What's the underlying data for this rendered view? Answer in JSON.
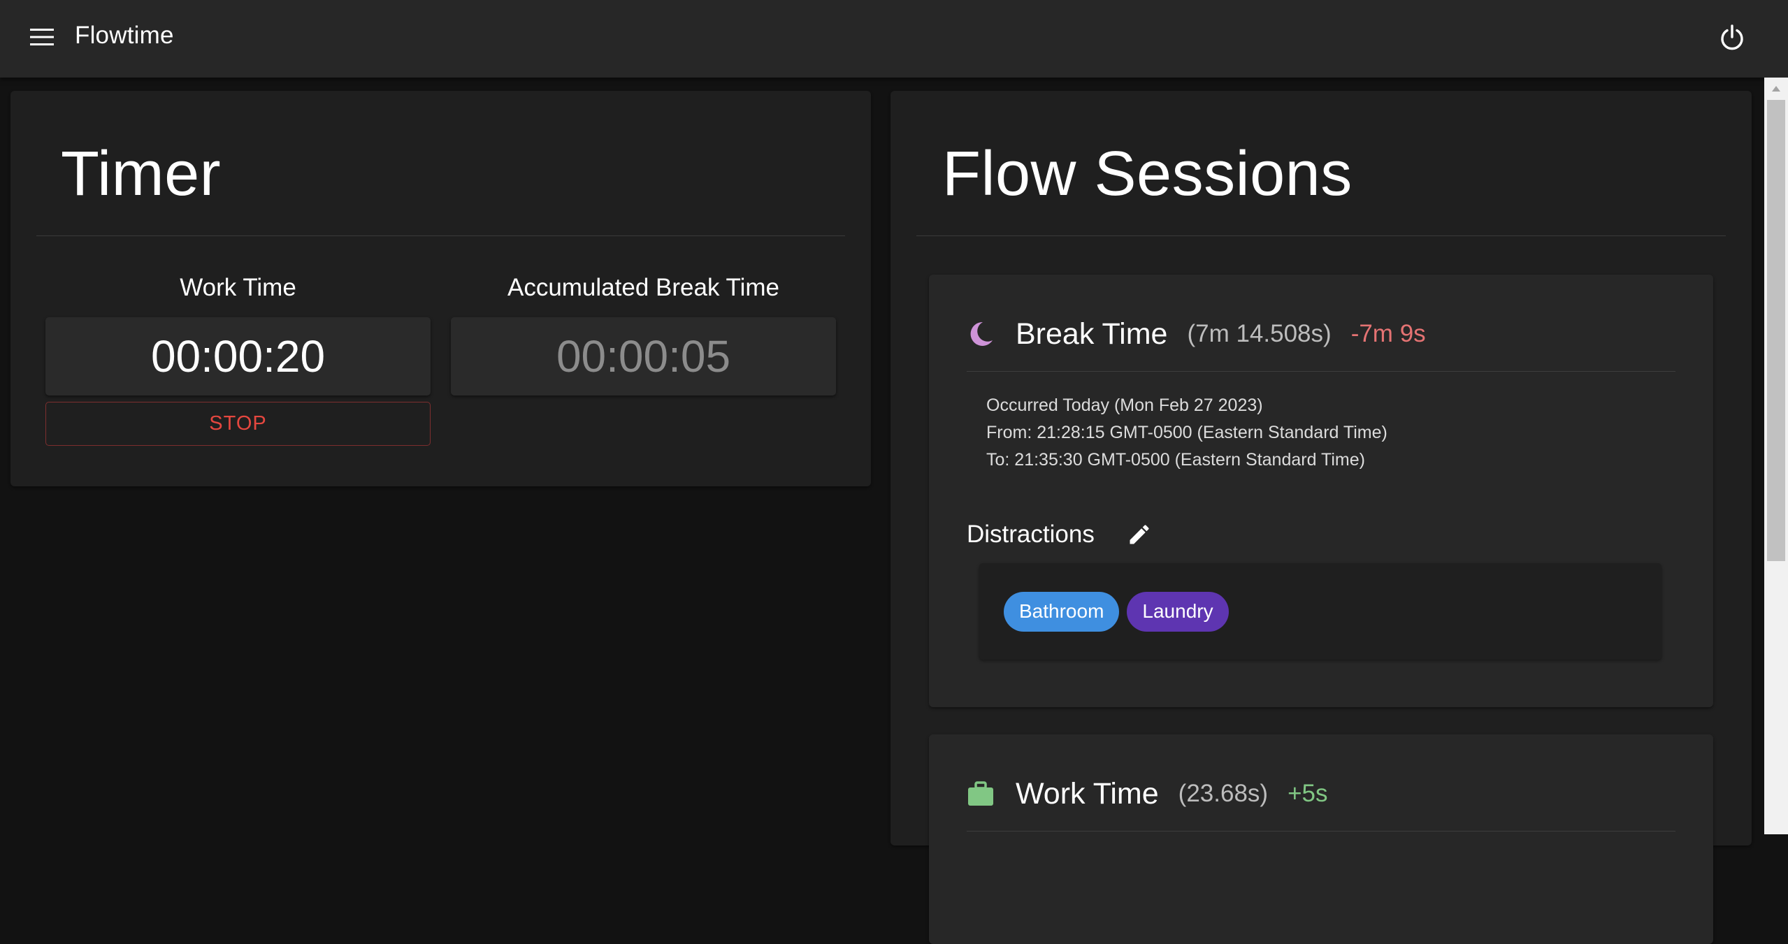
{
  "app": {
    "title": "Flowtime",
    "menu_icon": "hamburger-menu-icon",
    "power_icon": "power-icon"
  },
  "timer": {
    "title": "Timer",
    "work_label": "Work Time",
    "work_value": "00:00:20",
    "break_label": "Accumulated Break Time",
    "break_value": "00:00:05",
    "stop_label": "STOP"
  },
  "sessions": {
    "title": "Flow Sessions",
    "items": [
      {
        "type": "break",
        "icon": "moon-icon",
        "title": "Break Time",
        "duration": "(7m 14.508s)",
        "delta": "-7m 9s",
        "occurred": "Occurred Today (Mon Feb 27 2023)",
        "from": "From: 21:28:15 GMT-0500 (Eastern Standard Time)",
        "to": "To: 21:35:30 GMT-0500 (Eastern Standard Time)",
        "distractions_label": "Distractions",
        "distractions": [
          {
            "label": "Bathroom",
            "color": "#3f8fe0"
          },
          {
            "label": "Laundry",
            "color": "#5e35b1"
          }
        ]
      },
      {
        "type": "work",
        "icon": "briefcase-icon",
        "title": "Work Time",
        "duration": "(23.68s)",
        "delta": "+5s"
      }
    ]
  },
  "colors": {
    "background": "#121212",
    "appbar": "#272727",
    "panel": "#1f1f1f",
    "card": "#272727",
    "stop": "#e5473f",
    "negative_delta": "#e57373",
    "positive_delta": "#81c784",
    "moon": "#ce93d8",
    "briefcase": "#81c784"
  }
}
